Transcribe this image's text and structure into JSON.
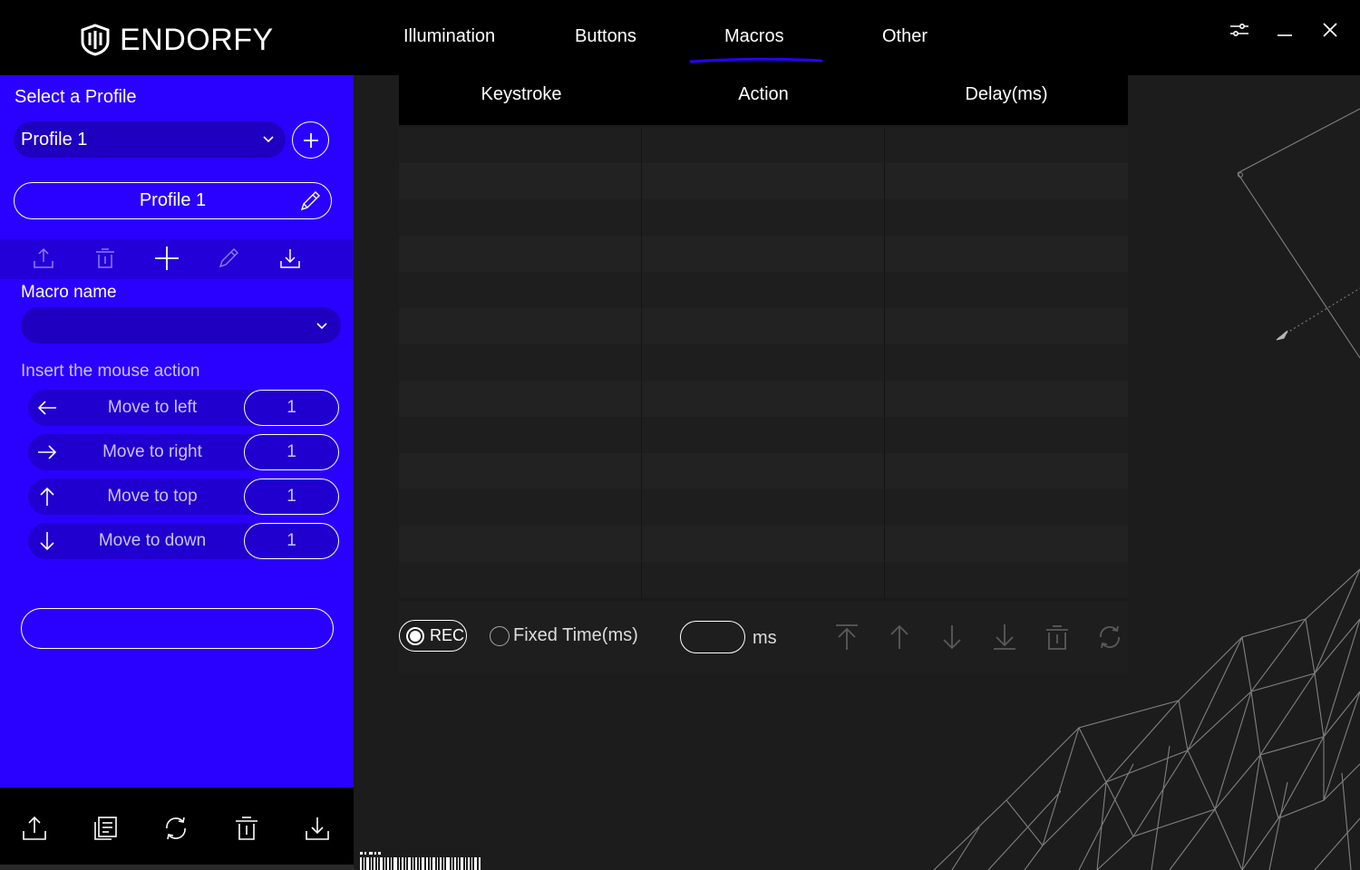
{
  "app": {
    "brand": "ENDORFY"
  },
  "nav": {
    "tabs": [
      {
        "label": "Illumination"
      },
      {
        "label": "Buttons"
      },
      {
        "label": "Macros"
      },
      {
        "label": "Other"
      }
    ],
    "active_tab": "Macros",
    "accent_color": "#2a00ff"
  },
  "window_controls": {
    "icons": [
      "settings-sliders-icon",
      "minimize-icon",
      "close-icon"
    ]
  },
  "sidebar": {
    "select_profile_title": "Select a Profile",
    "selected_profile": "Profile 1",
    "profile_name": "Profile 1",
    "macro_name_label": "Macro name",
    "macro_name_value": "",
    "insert_mouse_label": "Insert the mouse action",
    "mouse_actions": [
      {
        "label": "Move to left",
        "value": "1",
        "icon": "arrow-left-icon"
      },
      {
        "label": "Move to right",
        "value": "1",
        "icon": "arrow-right-icon"
      },
      {
        "label": "Move to top",
        "value": "1",
        "icon": "arrow-up-icon"
      },
      {
        "label": "Move to down",
        "value": "1",
        "icon": "arrow-down-icon"
      }
    ],
    "toolstrip_icons": [
      "export-icon",
      "delete-icon",
      "add-icon",
      "edit-icon",
      "import-icon"
    ],
    "footer_icons": [
      "export-icon",
      "copy-icon",
      "reset-icon",
      "delete-icon",
      "import-icon"
    ]
  },
  "macro_table": {
    "columns": [
      "Keystroke",
      "Action",
      "Delay(ms)"
    ],
    "rows": []
  },
  "controls": {
    "rec_label": "REC",
    "fixed_time_label": "Fixed Time(ms)",
    "ms_value": "",
    "ms_unit": "ms",
    "icons": [
      "move-to-top-icon",
      "move-up-icon",
      "move-down-icon",
      "move-to-bottom-icon",
      "delete-icon",
      "refresh-icon"
    ]
  }
}
